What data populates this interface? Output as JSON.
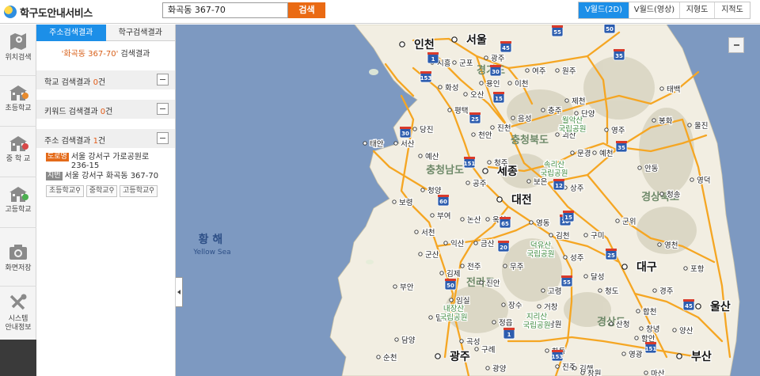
{
  "header": {
    "logo_text": "학구도안내서비스",
    "search_value": "화곡동 367-70",
    "search_button": "검색",
    "map_tabs": [
      "V월드(2D)",
      "V월드(영상)",
      "지형도",
      "지적도"
    ]
  },
  "rail": {
    "items": [
      "위치검색",
      "초등학교",
      "중 학 교",
      "고등학교",
      "화면저장",
      "시스템\n안내정보"
    ]
  },
  "panel": {
    "tabs": [
      "주소검색결과",
      "학구검색결과"
    ],
    "result_query": "'화곡동 367-70'",
    "result_suffix": " 검색결과",
    "school_result_label": "학교 검색결과 ",
    "school_result_count": "0",
    "school_result_unit": "건",
    "keyword_result_label": "키워드 검색결과 ",
    "keyword_result_count": "0",
    "keyword_result_unit": "건",
    "address_result_label": "주소 검색결과 ",
    "address_result_count": "1",
    "address_result_unit": "건",
    "road_tag": "도로명",
    "road_address": "서울 강서구 가로공원로 236-15",
    "jibun_tag": "지번",
    "jibun_address": "서울 강서구 화곡동 367-70",
    "school_buttons": [
      "초등학교",
      "중학교",
      "고등학교"
    ]
  },
  "map": {
    "sea_label": "황 해",
    "sea_label_en": "Yellow Sea",
    "provinces": [
      "경기도",
      "충청북도",
      "충청남도",
      "전라도",
      "경상북도",
      "경상도"
    ],
    "cities": [
      "인천",
      "서울",
      "세종",
      "대전",
      "광주",
      "대구",
      "울산",
      "부산"
    ],
    "towns": [
      "시흥",
      "군포",
      "광주",
      "화성",
      "용인",
      "이천",
      "오산",
      "평택",
      "충주",
      "제천",
      "원주",
      "여주",
      "진천",
      "음성",
      "단양",
      "영주",
      "봉화",
      "울진",
      "태백",
      "당진",
      "서산",
      "태안",
      "예산",
      "천안",
      "청주",
      "괴산",
      "문경",
      "예천",
      "안동",
      "청송",
      "영덕",
      "공주",
      "보은",
      "상주",
      "청양",
      "보령",
      "부여",
      "논산",
      "옥천",
      "영동",
      "김천",
      "군위",
      "서천",
      "익산",
      "금산",
      "구미",
      "영천",
      "포항",
      "군산",
      "전주",
      "무주",
      "성주",
      "경주",
      "김제",
      "진안",
      "고령",
      "달성",
      "청도",
      "부안",
      "임실",
      "장수",
      "거창",
      "합천",
      "밀양",
      "정읍",
      "남원",
      "산청",
      "창녕",
      "양산",
      "담양",
      "곡성",
      "구례",
      "하동",
      "진주",
      "김해",
      "함안",
      "영광",
      "순천",
      "광양",
      "창원",
      "마산"
    ],
    "parks": [
      "월악산\n국립공원",
      "속리산\n국립공원",
      "덕유산\n국립공원",
      "지리산\n국립공원",
      "내장산\n국립공원"
    ],
    "highways": [
      "55",
      "50",
      "45",
      "1",
      "153",
      "15",
      "25",
      "30",
      "35",
      "151",
      "12",
      "65",
      "20",
      "10",
      "60"
    ]
  }
}
